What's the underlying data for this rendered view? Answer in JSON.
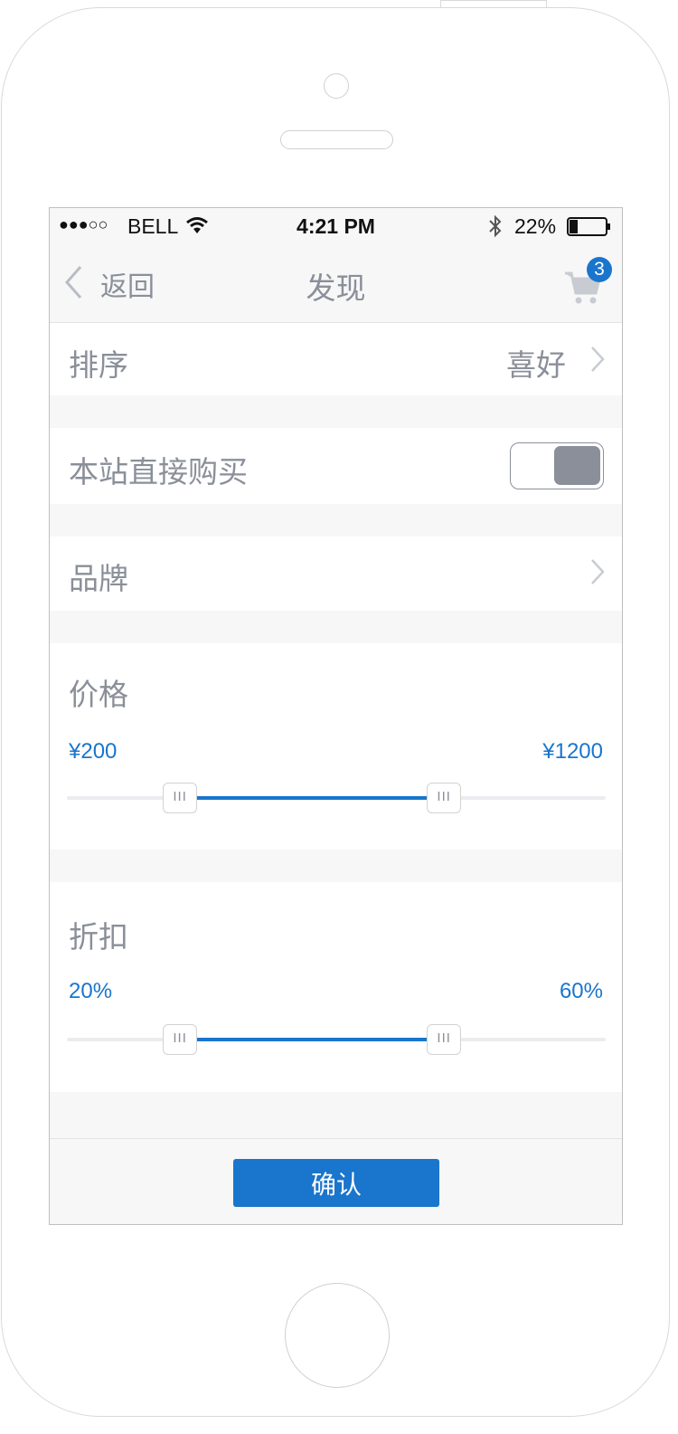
{
  "status_bar": {
    "signal": "●●●○○",
    "carrier": "BELL",
    "time": "4:21 PM",
    "battery_percent": "22%",
    "icons": [
      "wifi-icon",
      "bluetooth-icon",
      "battery-icon"
    ]
  },
  "nav": {
    "back_label": "返回",
    "title": "发现",
    "cart_badge": "3"
  },
  "sort": {
    "label": "排序",
    "value": "喜好"
  },
  "direct_buy": {
    "label": "本站直接购买",
    "toggle_on": true
  },
  "brand": {
    "label": "品牌"
  },
  "price": {
    "label": "价格",
    "min_label": "¥200",
    "max_label": "¥1200",
    "low_fraction": 0.21,
    "high_fraction": 0.7
  },
  "discount": {
    "label": "折扣",
    "min_label": "20%",
    "max_label": "60%",
    "low_fraction": 0.21,
    "high_fraction": 0.7
  },
  "thumb_glyph": "III",
  "footer": {
    "confirm_label": "确认"
  },
  "colors": {
    "accent": "#1a75cc",
    "label_gray": "#8a8f99",
    "background": "#f7f7f7"
  }
}
